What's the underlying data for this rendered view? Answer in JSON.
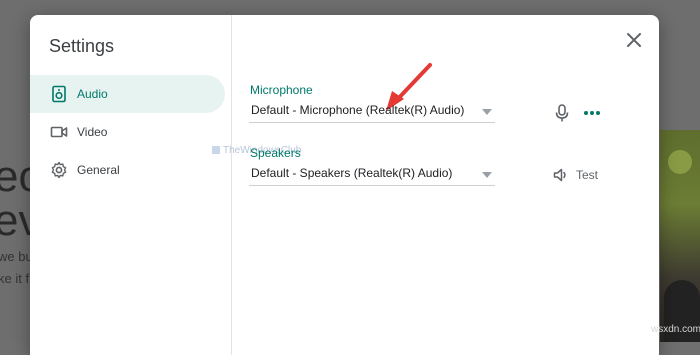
{
  "background": {
    "text_line_1": "eo",
    "text_line_2": "ev",
    "text_small_1": "we bu",
    "text_small_2": "ke it f"
  },
  "dialog": {
    "title": "Settings",
    "close_icon": "close-icon"
  },
  "sidebar": {
    "items": [
      {
        "label": "Audio",
        "icon": "speaker-icon",
        "active": true
      },
      {
        "label": "Video",
        "icon": "camera-icon",
        "active": false
      },
      {
        "label": "General",
        "icon": "gear-icon",
        "active": false
      }
    ]
  },
  "audio": {
    "microphone_label": "Microphone",
    "microphone_value": "Default - Microphone (Realtek(R) Audio)",
    "speakers_label": "Speakers",
    "speakers_value": "Default - Speakers (Realtek(R) Audio)",
    "test_label": "Test"
  },
  "watermark": "TheWindowsClub",
  "site_tag": "wsxdn.com",
  "colors": {
    "accent": "#00796b",
    "active_bg": "#e6f3f0",
    "arrow": "#e53935",
    "overlay": "#6e6e6e"
  }
}
